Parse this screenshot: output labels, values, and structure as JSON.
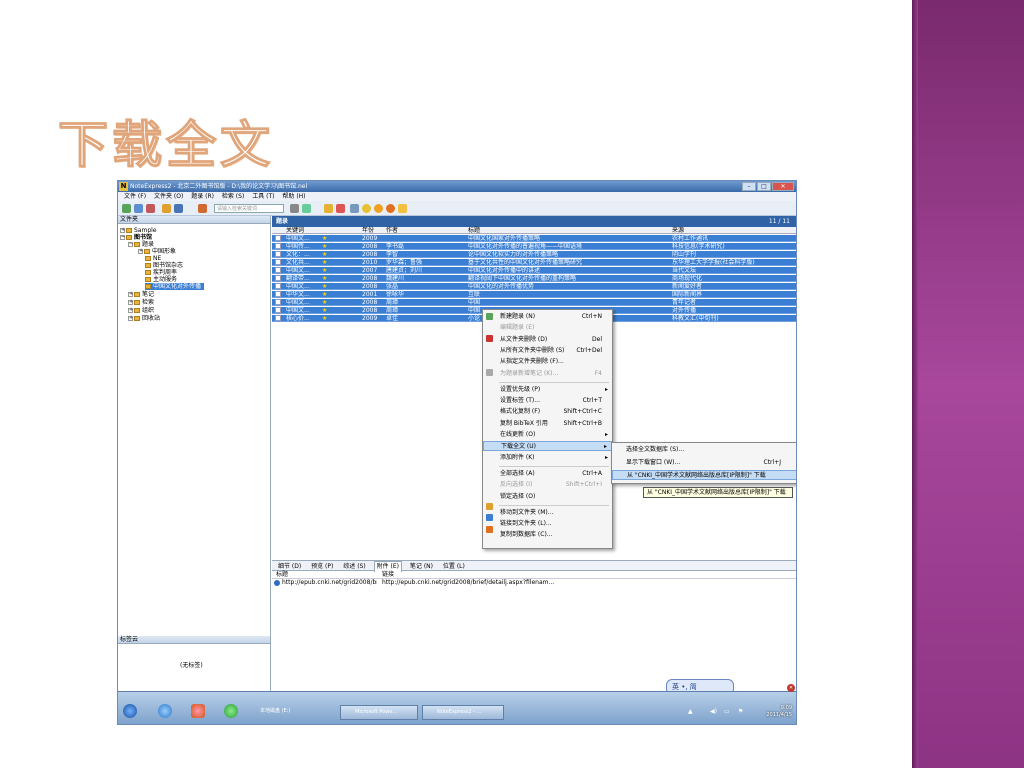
{
  "slide": {
    "title": "下载全文"
  },
  "window": {
    "title": "NoteExpress2 - 北京二外图书馆版 - D:\\我的论文学习\\图书馆.nel",
    "menu": [
      "文件 (F)",
      "文件夹 (O)",
      "题录 (R)",
      "检索 (S)",
      "工具 (T)",
      "帮助 (H)"
    ],
    "search_placeholder": "请输入检索关键词",
    "folder_panel_title": "文件夹",
    "tree": [
      {
        "label": "Sample",
        "expander": "+"
      },
      {
        "label": "图书馆",
        "expander": "−",
        "bold": true
      },
      {
        "label": "题录",
        "expander": "−"
      },
      {
        "label": "中国形象",
        "expander": "+"
      },
      {
        "label": "NE",
        "expander": ""
      },
      {
        "label": "图书馆杂志",
        "expander": ""
      },
      {
        "label": "疾判周率",
        "expander": ""
      },
      {
        "label": "主动服务",
        "expander": ""
      },
      {
        "label": "中国文化对外传播",
        "expander": "",
        "selected": true
      },
      {
        "label": "笔记",
        "expander": "+"
      },
      {
        "label": "检索",
        "expander": "+"
      },
      {
        "label": "组织",
        "expander": "+"
      },
      {
        "label": "回收站",
        "expander": "+"
      }
    ],
    "tag_panel_title": "标签云",
    "no_tags": "(无标签)",
    "list_title": "题录",
    "list_count": "11 / 11",
    "columns": {
      "keyword": "关键词",
      "year": "年份",
      "author": "作者",
      "title": "标题",
      "source": "来源"
    },
    "rows": [
      {
        "k": "中国文...",
        "y": "2009",
        "a": "",
        "t": "中国文化国家对外传播策略",
        "s": "农村工作通讯"
      },
      {
        "k": "中国传...",
        "y": "2008",
        "a": "李书磊",
        "t": "中国文化对外传播的普遍视角——中国语境",
        "s": "科技信息(学术研究)"
      },
      {
        "k": "文化：...",
        "y": "2008",
        "a": "李智",
        "t": "论中国文化软实力的对外传播策略",
        "s": "阴山学刊"
      },
      {
        "k": "文化共...",
        "y": "2010",
        "a": "罗华森；鲁强",
        "t": "基于文化共性的中国文化对外传播策略研究",
        "s": "东华理工大学学报(社会科学版)"
      },
      {
        "k": "中国文...",
        "y": "2007",
        "a": "唐建贞；刘川",
        "t": "中国文化对外传播中的讲述",
        "s": "当代文坛"
      },
      {
        "k": "翻译带...",
        "y": "2008",
        "a": "魏建川",
        "t": "翻译视阈下中国文化对外传播的重构策略",
        "s": "商场现代化"
      },
      {
        "k": "中国文...",
        "y": "2008",
        "a": "张晶",
        "t": "中国文化的对外传播优势",
        "s": "新闻爱好者"
      },
      {
        "k": "中华文...",
        "y": "2001",
        "a": "徐咏华",
        "t": "互联",
        "s": "国际新闻界"
      },
      {
        "k": "中国文...",
        "y": "2008",
        "a": "周璋",
        "t": "中国",
        "s": "青年记者"
      },
      {
        "k": "中国文...",
        "y": "2008",
        "a": "周璋",
        "t": "中国",
        "s": "对外传播"
      },
      {
        "k": "核心价...",
        "y": "2009",
        "a": "卓佳",
        "t": "小论",
        "s": "科教文汇(中旬刊)"
      }
    ],
    "context_menu": [
      {
        "label": "新建题录 (N)",
        "shortcut": "Ctrl+N"
      },
      {
        "label": "编辑题录 (E)",
        "shortcut": "",
        "disabled": true
      },
      {
        "label": "从文件夹删除 (D)",
        "shortcut": "Del"
      },
      {
        "label": "从所有文件夹中删除 (S)",
        "shortcut": "Ctrl+Del"
      },
      {
        "label": "从指定文件夹删除 (F)...",
        "shortcut": ""
      },
      {
        "label": "为题录新增笔记 (K)...",
        "shortcut": "F4",
        "disabled": true
      },
      {
        "label": "设置优先级 (P)",
        "shortcut": "",
        "arrow": true
      },
      {
        "label": "设置标签 (T)...",
        "shortcut": "Ctrl+T"
      },
      {
        "label": "格式化复制 (F)",
        "shortcut": "Shift+Ctrl+C"
      },
      {
        "label": "复制 BibTeX 引用",
        "shortcut": "Shift+Ctrl+B"
      },
      {
        "label": "在线更新 (O)",
        "shortcut": "",
        "arrow": true
      },
      {
        "label": "下载全文 (U)",
        "shortcut": "",
        "arrow": true,
        "highlight": true
      },
      {
        "label": "添加附件 (K)",
        "shortcut": "",
        "arrow": true
      },
      {
        "label": "全部选择 (A)",
        "shortcut": "Ctrl+A"
      },
      {
        "label": "反向选择 (I)",
        "shortcut": "Shift+Ctrl+I",
        "disabled": true
      },
      {
        "label": "锁定选择 (O)",
        "shortcut": ""
      },
      {
        "label": "移动到文件夹 (M)...",
        "shortcut": ""
      },
      {
        "label": "链接到文件夹 (L)...",
        "shortcut": ""
      },
      {
        "label": "复制到数据库 (C)...",
        "shortcut": ""
      }
    ],
    "submenu": [
      {
        "label": "选择全文数据库 (S)...",
        "shortcut": ""
      },
      {
        "label": "显示下载窗口 (W)...",
        "shortcut": "Ctrl+J"
      },
      {
        "label": "从 \"CNKI_中国学术文献网络出版总库[IP限制]\" 下载",
        "shortcut": "",
        "highlight": true
      }
    ],
    "tooltip": "从 \"CNKI_中国学术文献网络出版总库[IP限制]\" 下载",
    "bottom_tabs": [
      "细节 (D)",
      "预览 (P)",
      "综述 (S)",
      "附件 (E)",
      "笔记 (N)",
      "位置 (L)"
    ],
    "attach_cols": {
      "title": "标题",
      "link": "链接"
    },
    "attach_row": {
      "title": "http://epub.cnki.net/grid2008/bri...",
      "link": "http://epub.cnki.net/grid2008/brief/detailj.aspx?filenam..."
    }
  },
  "taskbar": {
    "items": [
      "本地磁盘 (E:)",
      "Microsoft Powe...",
      "NoteExpress2 - ..."
    ],
    "ime": "英 •, 简",
    "time": "9:09",
    "date": "2011/4/15"
  }
}
